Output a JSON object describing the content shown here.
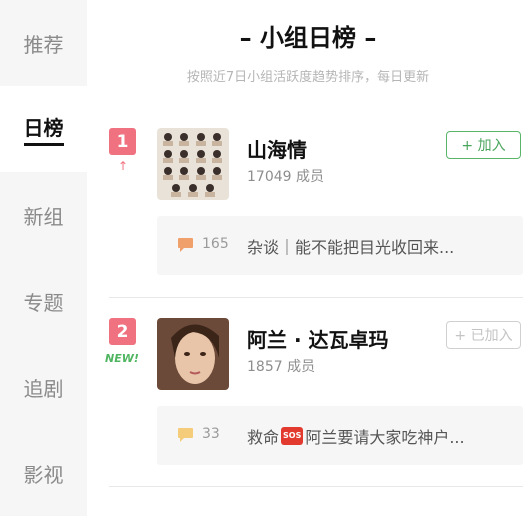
{
  "sidebar": {
    "items": [
      {
        "label": "推荐",
        "active": false
      },
      {
        "label": "日榜",
        "active": true
      },
      {
        "label": "新组",
        "active": false
      },
      {
        "label": "专题",
        "active": false
      },
      {
        "label": "追剧",
        "active": false
      },
      {
        "label": "影视",
        "active": false
      }
    ]
  },
  "header": {
    "title": "– 小组日榜 –",
    "subtitle": "按照近7日小组活跃度趋势排序，每日更新"
  },
  "groups": [
    {
      "rank": "1",
      "trend": "↑",
      "name": "山海情",
      "members": "17049 成员",
      "join_label": "+ 加入",
      "post_count": "165",
      "post_title": "杂谈｜能不能把目光收回来...",
      "badge_color": "#f0717f",
      "bubble_color": "#f0a06a"
    },
    {
      "rank": "2",
      "tag": "NEW!",
      "name": "阿兰 · 达瓦卓玛",
      "members": "1857 成员",
      "join_label": "+ 已加入",
      "post_count": "33",
      "post_prefix": "救命",
      "post_badge": "SOS",
      "post_title": "阿兰要请大家吃神户...",
      "badge_color": "#f0717f",
      "bubble_color": "#f5cd7a"
    }
  ]
}
